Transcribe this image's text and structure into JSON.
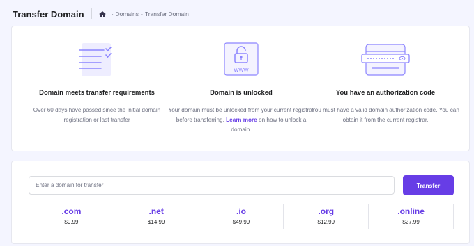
{
  "header": {
    "title": "Transfer Domain",
    "breadcrumb": [
      "Domains",
      "Transfer Domain"
    ],
    "separator": "-"
  },
  "features": [
    {
      "icon": "checklist-icon",
      "title": "Domain meets transfer requirements",
      "description": "Over 60 days have passed since the initial domain registration or last transfer"
    },
    {
      "icon": "lock-www-icon",
      "title": "Domain is unlocked",
      "description_before": "Your domain must be unlocked from your current registrar before transferring. ",
      "link_text": "Learn more",
      "description_after": " on how to unlock a domain.",
      "icon_text": "WWW"
    },
    {
      "icon": "password-field-icon",
      "title": "You have an authorization code",
      "description": "You must have a valid domain authorization code. You can obtain it from the current registrar."
    }
  ],
  "transfer": {
    "input_value": "",
    "input_placeholder": "Enter a domain for transfer",
    "button_label": "Transfer"
  },
  "tlds": [
    {
      "ext": ".com",
      "price": "$9.99"
    },
    {
      "ext": ".net",
      "price": "$14.99"
    },
    {
      "ext": ".io",
      "price": "$49.99"
    },
    {
      "ext": ".org",
      "price": "$12.99"
    },
    {
      "ext": ".online",
      "price": "$27.99"
    }
  ],
  "colors": {
    "accent": "#673de6",
    "illustration_stroke": "#8c85ff",
    "background": "#f4f5ff"
  }
}
